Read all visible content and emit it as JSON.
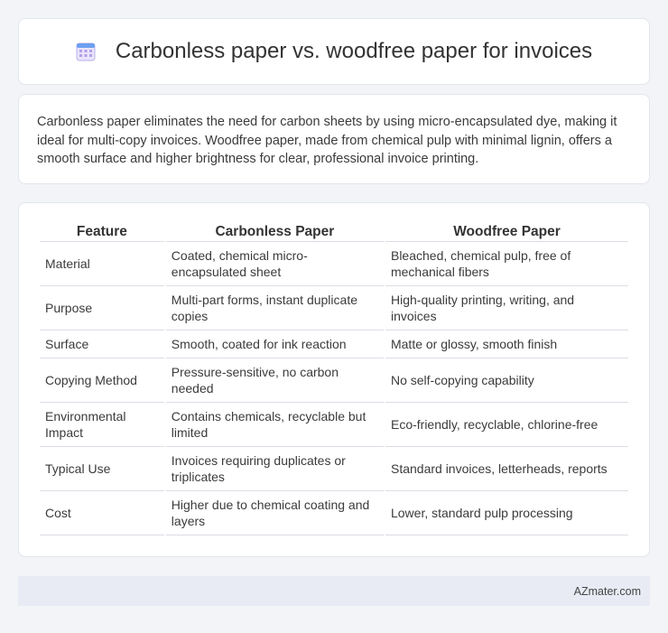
{
  "header": {
    "title": "Carbonless paper vs. woodfree paper for invoices",
    "icon": "calendar-icon"
  },
  "summary": {
    "text": "Carbonless paper eliminates the need for carbon sheets by using micro-encapsulated dye, making it ideal for multi-copy invoices. Woodfree paper, made from chemical pulp with minimal lignin, offers a smooth surface and higher brightness for clear, professional invoice printing."
  },
  "table": {
    "headers": [
      "Feature",
      "Carbonless Paper",
      "Woodfree Paper"
    ],
    "rows": [
      [
        "Material",
        "Coated, chemical micro-encapsulated sheet",
        "Bleached, chemical pulp, free of mechanical fibers"
      ],
      [
        "Purpose",
        "Multi-part forms, instant duplicate copies",
        "High-quality printing, writing, and invoices"
      ],
      [
        "Surface",
        "Smooth, coated for ink reaction",
        "Matte or glossy, smooth finish"
      ],
      [
        "Copying Method",
        "Pressure-sensitive, no carbon needed",
        "No self-copying capability"
      ],
      [
        "Environmental Impact",
        "Contains chemicals, recyclable but limited",
        "Eco-friendly, recyclable, chlorine-free"
      ],
      [
        "Typical Use",
        "Invoices requiring duplicates or triplicates",
        "Standard invoices, letterheads, reports"
      ],
      [
        "Cost",
        "Higher due to chemical coating and layers",
        "Lower, standard pulp processing"
      ]
    ]
  },
  "footer": {
    "brand": "AZmater.com"
  }
}
